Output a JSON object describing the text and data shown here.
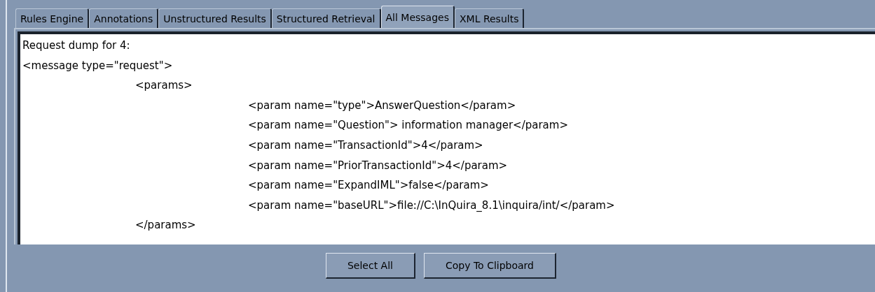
{
  "tabs": [
    {
      "label": "Rules Engine",
      "selected": false
    },
    {
      "label": "Annotations",
      "selected": false
    },
    {
      "label": "Unstructured Results",
      "selected": false
    },
    {
      "label": "Structured Retrieval",
      "selected": false
    },
    {
      "label": "All Messages",
      "selected": true
    },
    {
      "label": "XML Results",
      "selected": false
    }
  ],
  "message_dump": {
    "lines": [
      {
        "text": "Request dump for 4:"
      },
      {
        "text": "<message type=\"request\">",
        "children": [
          {
            "text": "<params>",
            "children": [
              {
                "text": "<param name=\"type\">AnswerQuestion</param>"
              },
              {
                "text": "<param name=\"Question\"> information manager</param>"
              },
              {
                "text": "<param name=\"TransactionId\">4</param>"
              },
              {
                "text": "<param name=\"PriorTransactionId\">4</param>"
              },
              {
                "text": "<param name=\"ExpandIML\">false</param>"
              },
              {
                "text": "<param name=\"baseURL\">file://C:\\InQuira_8.1\\inquira/int/</param>"
              }
            ]
          },
          {
            "text": "</params>"
          }
        ]
      }
    ]
  },
  "buttons": [
    "Select All",
    "Copy To Clipboard"
  ]
}
